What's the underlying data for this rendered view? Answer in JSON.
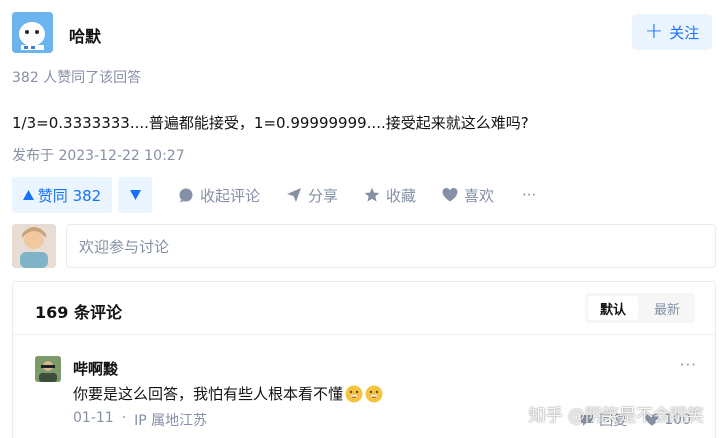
{
  "author": {
    "name": "哈默",
    "follow_label": "关注"
  },
  "answer": {
    "voters_text": "382 人赞同了该回答",
    "body": "1/3=0.3333333....普遍都能接受，1=0.99999999....接受起来就这么难吗?",
    "published": "发布于 2023-12-22 10:27"
  },
  "actions": {
    "vote_up_label": "赞同 382",
    "collapse_comments": "收起评论",
    "share": "分享",
    "collect": "收藏",
    "like": "喜欢",
    "more": "···"
  },
  "comment_box": {
    "placeholder": "欢迎参与讨论"
  },
  "comments": {
    "title": "169 条评论",
    "sort": {
      "default": "默认",
      "latest": "最新"
    },
    "items": [
      {
        "user": "哔啊黢",
        "text": "你要是这么回答，我怕有些人根本看不懂",
        "date": "01-11",
        "location": "IP 属地江苏",
        "reply_label": "回复",
        "likes": "100"
      }
    ]
  },
  "watermark": "知乎 @阴笑是不会阴笑",
  "colors": {
    "accent": "#1772f6",
    "accent_bg": "#ebf5ff",
    "muted": "#8590a6"
  }
}
